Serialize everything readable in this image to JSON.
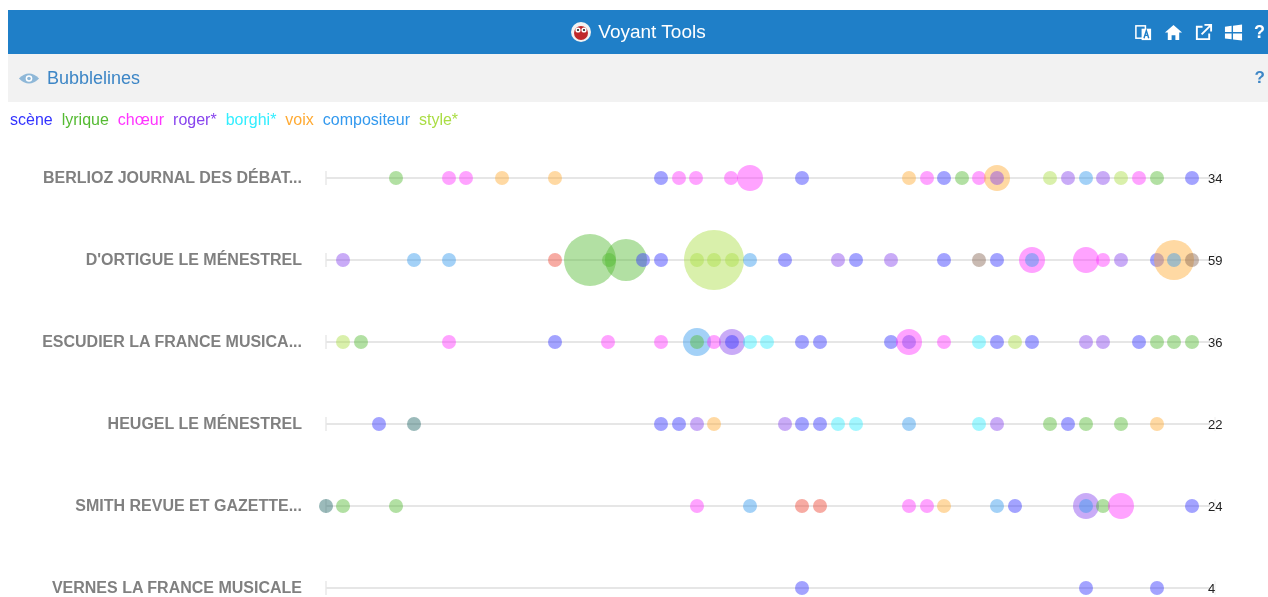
{
  "header": {
    "title": "Voyant Tools",
    "help": "?"
  },
  "panel": {
    "title": "Bubblelines",
    "help": "?"
  },
  "terms": [
    {
      "label": "scène",
      "color": "#3333ff"
    },
    {
      "label": "lyrique",
      "color": "#55bb33"
    },
    {
      "label": "chœur",
      "color": "#ff33ff"
    },
    {
      "label": "roger*",
      "color": "#8844ee"
    },
    {
      "label": "borghi*",
      "color": "#33eeff"
    },
    {
      "label": "voix",
      "color": "#ffaa33"
    },
    {
      "label": "compositeur",
      "color": "#3399ee"
    },
    {
      "label": "style*",
      "color": "#aadd44"
    }
  ],
  "documents": [
    {
      "title": "BERLIOZ JOURNAL DES DÉBAT...",
      "count": "34"
    },
    {
      "title": "D'ORTIGUE LE MÉNESTREL",
      "count": "59"
    },
    {
      "title": "ESCUDIER LA FRANCE MUSICA...",
      "count": "36"
    },
    {
      "title": "HEUGEL LE MÉNESTREL",
      "count": "22"
    },
    {
      "title": "SMITH REVUE ET GAZETTE...",
      "count": "24"
    },
    {
      "title": "VERNES LA FRANCE MUSICALE",
      "count": "4"
    }
  ]
}
